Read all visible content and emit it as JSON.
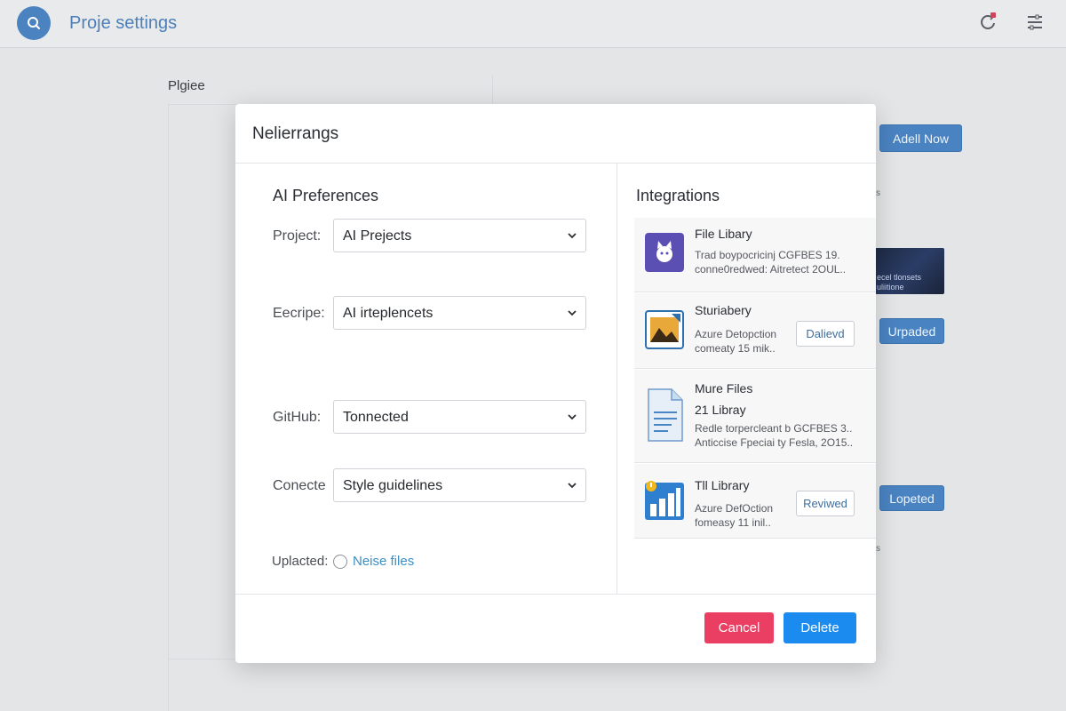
{
  "topbar": {
    "title": "Proje  settings"
  },
  "background": {
    "heading": "Plgiee",
    "buttons": {
      "add_now": "Adell Now",
      "updated": "Urpaded",
      "loaded": "Lopeted"
    },
    "thumbnail_text": "ecel tlonsets\nuliitione",
    "dash_marks": [
      "s",
      "s",
      "s"
    ]
  },
  "modal": {
    "title": "Nelierrangs",
    "preferences": {
      "title": "AI Preferences",
      "fields": [
        {
          "label": "Project:",
          "value": "AI Prejects"
        },
        {
          "label": "Eecripe:",
          "value": "AI irteplencets"
        },
        {
          "label": "GitHub:",
          "value": "Tonnected"
        },
        {
          "label": "Conecte",
          "value": "Style guidelines"
        }
      ],
      "radio": {
        "label": "Uplacted:",
        "option": "Neise files"
      }
    },
    "integrations": {
      "title": "Integrations",
      "items": [
        {
          "name": "File Libary",
          "desc_1": "Trad boypocricinj CGFBES 19.",
          "desc_2": "conne0redwed: Aitretect 2OUL..",
          "button": ""
        },
        {
          "name": "Sturiabery",
          "desc_1": "Azure Detopction",
          "desc_2": "comeaty 15 mik..",
          "button": "Dalievd"
        },
        {
          "name": "Mure Files",
          "name_2": "21 Libray",
          "desc_1": "Redle torpercleant b GCFBES 3..",
          "desc_2": "Anticcise Fpeciai ty Fesla, 2O15..",
          "button": ""
        },
        {
          "name": "Tll Library",
          "desc_1": "Azure DefOction",
          "desc_2": "fomeasy 11 inil..",
          "button": "Reviwed"
        }
      ]
    },
    "footer": {
      "cancel": "Cancel",
      "delete": "Delete"
    }
  },
  "colors": {
    "accent_blue": "#4a83c1",
    "cancel_red": "#ea3f63",
    "delete_blue": "#1b8bf0",
    "link_blue": "#3a8fc4"
  }
}
